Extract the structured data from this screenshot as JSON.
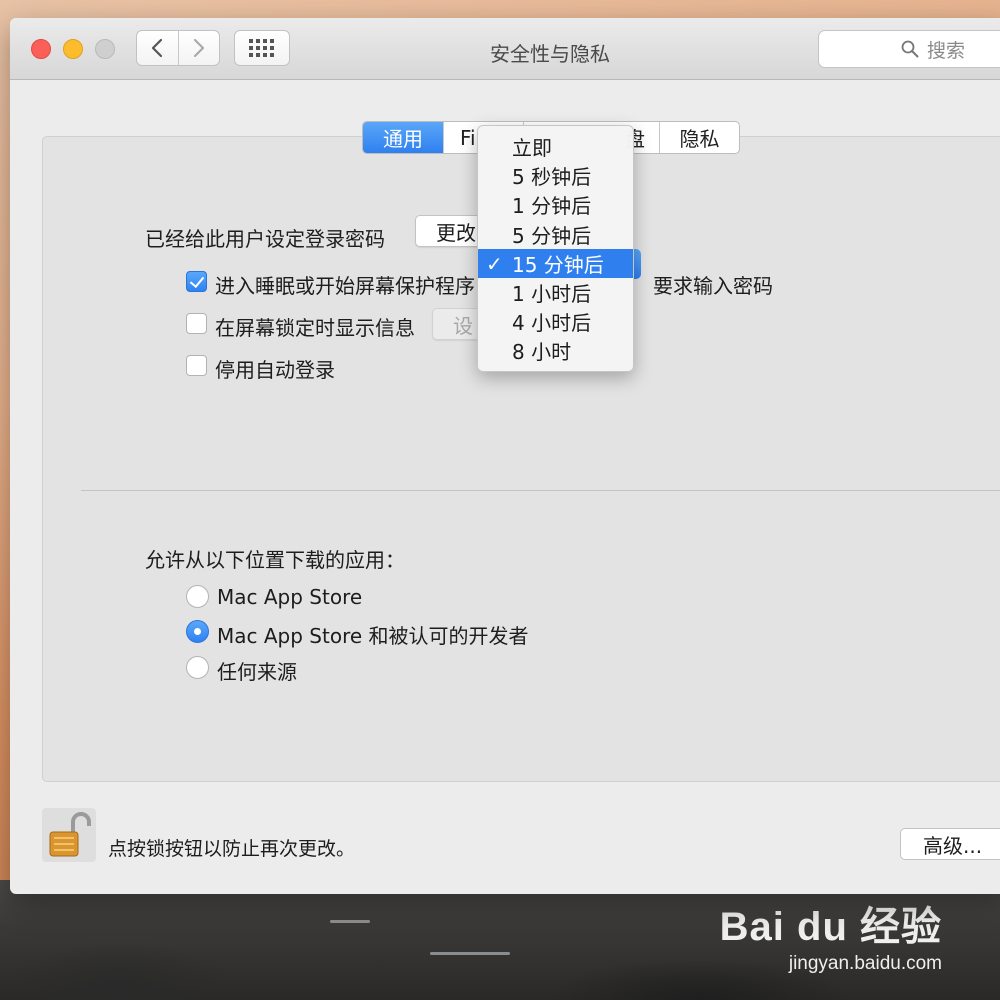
{
  "window": {
    "title": "安全性与隐私",
    "search_placeholder": "搜索"
  },
  "tabs": [
    {
      "label": "通用",
      "active": true
    },
    {
      "label": "Fi"
    },
    {
      "label": "盘"
    },
    {
      "label": "隐私"
    }
  ],
  "general": {
    "password_label": "已经给此用户设定登录密码",
    "change_password_button": "更改",
    "require_password": {
      "checked": true,
      "label": "进入睡眠或开始屏幕保护程序",
      "suffix": "要求输入密码"
    },
    "lock_message": {
      "checked": false,
      "label": "在屏幕锁定时显示信息",
      "button": "设"
    },
    "disable_autologin": {
      "checked": false,
      "label": "停用自动登录"
    }
  },
  "delay_menu": {
    "items": [
      "立即",
      "5 秒钟后",
      "1 分钟后",
      "5 分钟后",
      "15 分钟后",
      "1 小时后",
      "4 小时后",
      "8 小时"
    ],
    "selected_index": 4,
    "check_mark": "✓"
  },
  "downloads": {
    "heading": "允许从以下位置下载的应用：",
    "options": [
      {
        "label": "Mac App Store",
        "selected": false
      },
      {
        "label": "Mac App Store 和被认可的开发者",
        "selected": true
      },
      {
        "label": "任何来源",
        "selected": false
      }
    ]
  },
  "footer": {
    "lock_text": "点按锁按钮以防止再次更改。",
    "advanced_button": "高级..."
  },
  "watermark": {
    "logo": "Bai du 经验",
    "url": "jingyan.baidu.com"
  },
  "colors": {
    "accent": "#2f7fef",
    "close": "#fc5f57",
    "minimize": "#fdbc2e"
  }
}
